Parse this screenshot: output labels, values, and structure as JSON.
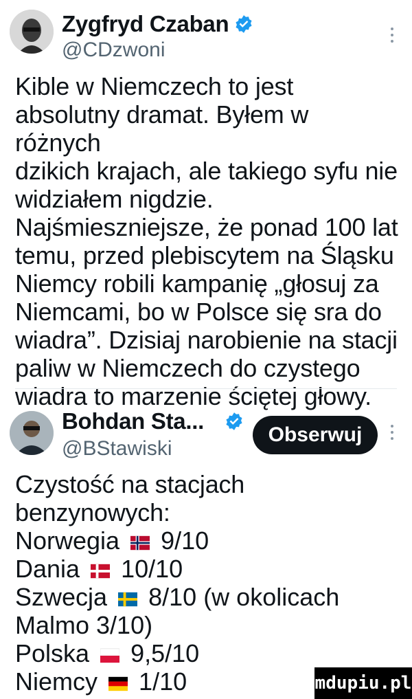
{
  "tweet1": {
    "author_name": "Zygfryd Czaban",
    "handle": "@CDzwoni",
    "text": "Kible w Niemczech to jest\nabsolutny dramat. Byłem w różnych\ndzikich krajach, ale takiego syfu nie\nwidziałem nigdzie.\nNajśmieszniejsze, że ponad 100 lat\ntemu, przed plebiscytem na Śląsku\nNiemcy robili kampanię „głosuj za\nNiemcami, bo w Polsce się sra do\nwiadra”. Dzisiaj narobienie na stacji\npaliw w Niemczech do czystego\nwiadra to marzenie ściętej głowy."
  },
  "tweet2": {
    "author_name": "Bohdan Sta...",
    "handle": "@BStawiski",
    "follow_label": "Obserwuj",
    "intro": "Czystość na stacjach\nbenzynowych:",
    "ratings": [
      {
        "country": "Norwegia",
        "flag": "norway-flag",
        "score": "9/10",
        "extra": ""
      },
      {
        "country": "Dania",
        "flag": "denmark-flag",
        "score": "10/10",
        "extra": ""
      },
      {
        "country": "Szwecja",
        "flag": "sweden-flag",
        "score": "8/10",
        "extra": "(w okolicach"
      },
      {
        "country": "",
        "flag": "",
        "score": "",
        "extra": "Malmo 3/10)"
      },
      {
        "country": "Polska",
        "flag": "poland-flag",
        "score": "9,5/10",
        "extra": ""
      },
      {
        "country": "Niemcy",
        "flag": "germany-flag",
        "score": "1/10",
        "extra": ""
      }
    ]
  },
  "watermark": "mdupiu.pl",
  "colors": {
    "verified": "#1d9bf0",
    "text": "#0f1419",
    "muted": "#536471"
  }
}
